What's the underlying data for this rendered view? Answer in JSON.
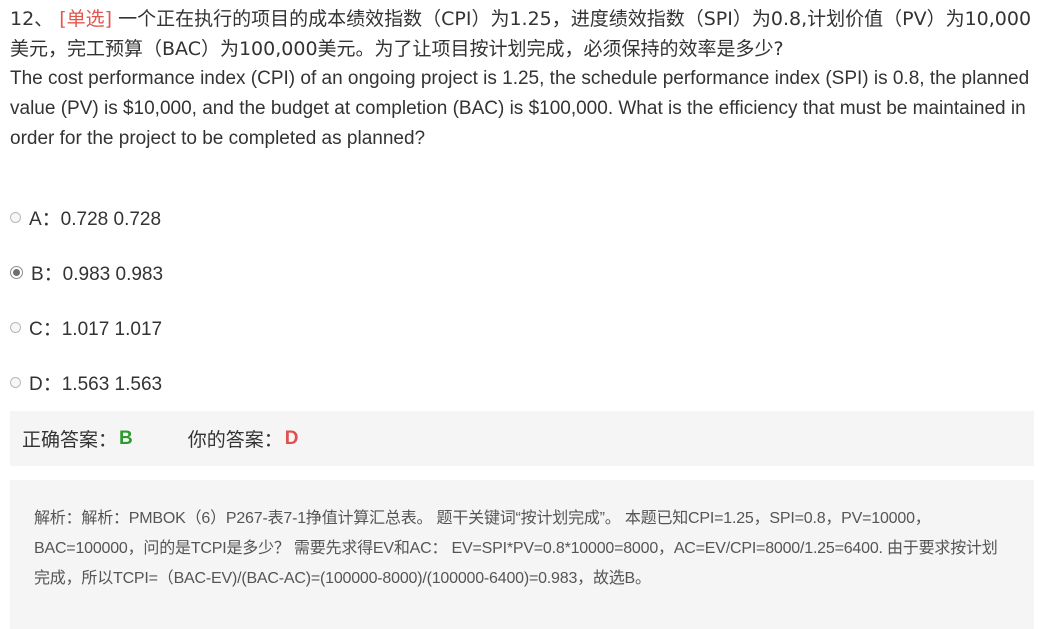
{
  "question": {
    "number": "12、",
    "type_tag": "[单选]",
    "text_cn": "一个正在执行的项目的成本绩效指数（CPI）为1.25，进度绩效指数（SPI）为0.8,计划价值（PV）为10,000美元，完工预算（BAC）为100,000美元。为了让项目按计划完成，必须保持的效率是多少?",
    "text_en": "The cost performance index (CPI) of an ongoing project is 1.25, the schedule performance index (SPI) is 0.8, the planned value (PV) is $10,000, and the budget at completion (BAC) is $100,000. What is the efficiency that must be maintained in order for the project to be completed as planned?"
  },
  "options": [
    {
      "text": "A：0.728 0.728",
      "selected": false
    },
    {
      "text": "B：0.983 0.983",
      "selected": true
    },
    {
      "text": "C：1.017 1.017",
      "selected": false
    },
    {
      "text": "D：1.563 1.563",
      "selected": false
    }
  ],
  "answer": {
    "correct_label": "正确答案：",
    "correct_value": "B",
    "yours_label": "你的答案：",
    "yours_value": "D",
    "colors": {
      "correct": "#2e9a2e",
      "yours": "#e05050"
    }
  },
  "analysis": {
    "text": "解析：解析：PMBOK（6）P267-表7-1挣值计算汇总表。 题干关键词“按计划完成”。 本题已知CPI=1.25，SPI=0.8，PV=10000，BAC=100000，问的是TCPI是多少？ 需要先求得EV和AC： EV=SPI*PV=0.8*10000=8000，AC=EV/CPI=8000/1.25=6400. 由于要求按计划完成，所以TCPI=（BAC-EV)/(BAC-AC)=(100000-8000)/(100000-6400)=0.983，故选B。"
  }
}
